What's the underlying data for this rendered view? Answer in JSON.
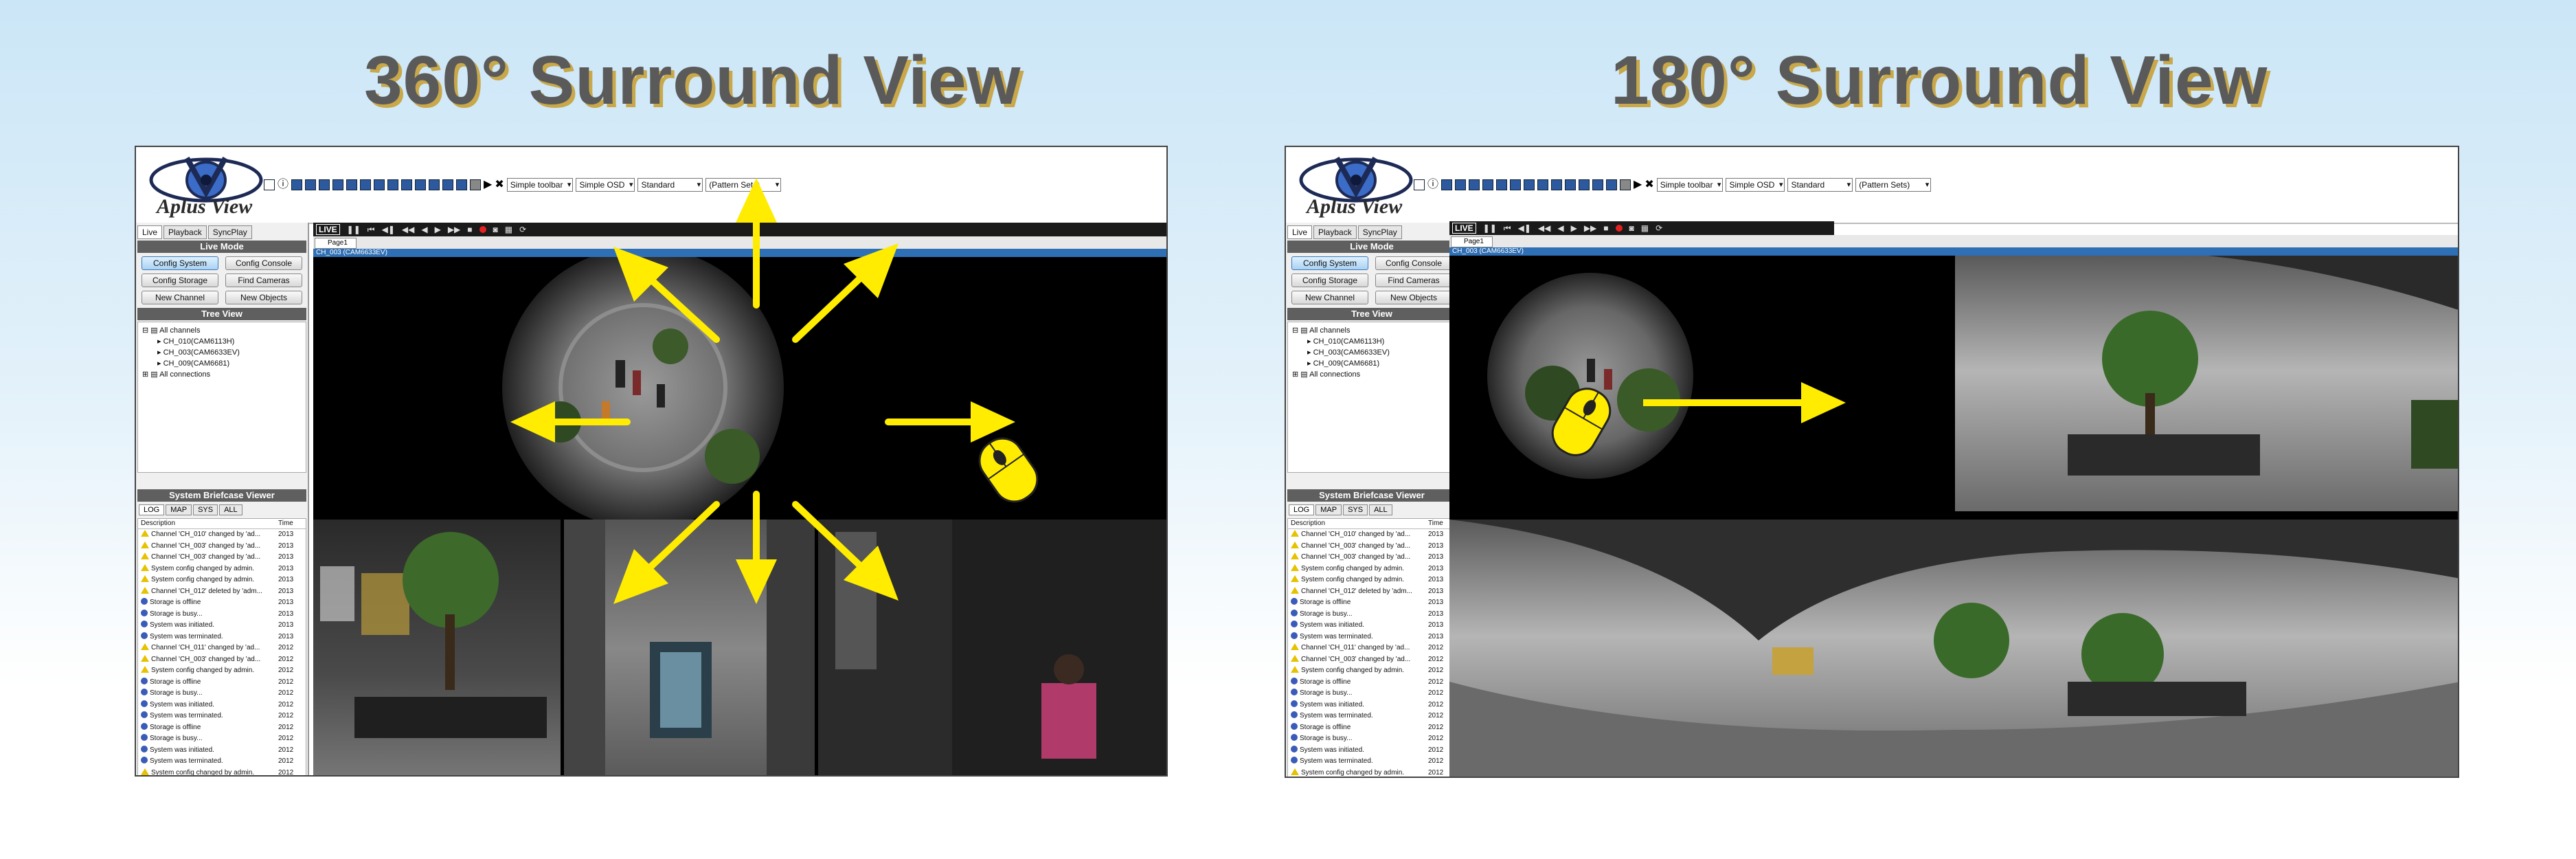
{
  "headings": {
    "left": "360° Surround View",
    "right": "180° Surround View"
  },
  "app": {
    "logo_text": "Aplus View",
    "toolbar_selects": [
      "Simple toolbar",
      "Simple OSD",
      "Standard",
      "(Pattern Sets)"
    ],
    "left_tabs": [
      "Live",
      "Playback",
      "SyncPlay"
    ],
    "live_mode_title": "Live Mode",
    "buttons": [
      "Config System",
      "Config Console",
      "Config Storage",
      "Find Cameras",
      "New Channel",
      "New Objects"
    ],
    "tree_view_title": "Tree View",
    "tree": [
      "All channels",
      "CH_010(CAM6113H)",
      "CH_003(CAM6633EV)",
      "CH_009(CAM6681)",
      "All connections"
    ],
    "briefcase_title": "System Briefcase Viewer",
    "log_tabs": [
      "LOG",
      "MAP",
      "SYS",
      "ALL"
    ],
    "log_header": {
      "desc": "Description",
      "time": "Time"
    },
    "live_label": "LIVE",
    "page_tab": "Page1",
    "cam_title": "CH_003 (CAM6633EV)"
  },
  "log_left": [
    {
      "icon": "warn",
      "text": "Channel 'CH_010' changed by 'ad...",
      "time": "2013"
    },
    {
      "icon": "warn",
      "text": "Channel 'CH_003' changed by 'ad...",
      "time": "2013"
    },
    {
      "icon": "warn",
      "text": "Channel 'CH_003' changed by 'ad...",
      "time": "2013"
    },
    {
      "icon": "warn",
      "text": "System config changed by admin.",
      "time": "2013"
    },
    {
      "icon": "warn",
      "text": "System config changed by admin.",
      "time": "2013"
    },
    {
      "icon": "warn",
      "text": "Channel 'CH_012' deleted by 'adm...",
      "time": "2013"
    },
    {
      "icon": "info",
      "text": "Storage is offline",
      "time": "2013"
    },
    {
      "icon": "info",
      "text": "Storage is busy...",
      "time": "2013"
    },
    {
      "icon": "info",
      "text": "System was initiated.",
      "time": "2013"
    },
    {
      "icon": "info",
      "text": "System was terminated.",
      "time": "2013"
    },
    {
      "icon": "warn",
      "text": "Channel 'CH_011' changed by 'ad...",
      "time": "2012"
    },
    {
      "icon": "warn",
      "text": "Channel 'CH_003' changed by 'ad...",
      "time": "2012"
    },
    {
      "icon": "warn",
      "text": "System config changed by admin.",
      "time": "2012"
    },
    {
      "icon": "info",
      "text": "Storage is offline",
      "time": "2012"
    },
    {
      "icon": "info",
      "text": "Storage is busy...",
      "time": "2012"
    },
    {
      "icon": "info",
      "text": "System was initiated.",
      "time": "2012"
    },
    {
      "icon": "info",
      "text": "System was terminated.",
      "time": "2012"
    },
    {
      "icon": "info",
      "text": "Storage is offline",
      "time": "2012"
    },
    {
      "icon": "info",
      "text": "Storage is busy...",
      "time": "2012"
    },
    {
      "icon": "info",
      "text": "System was initiated.",
      "time": "2012"
    },
    {
      "icon": "info",
      "text": "System was terminated.",
      "time": "2012"
    },
    {
      "icon": "warn",
      "text": "System config changed by admin.",
      "time": "2012"
    },
    {
      "icon": "warn",
      "text": "System config changed by admin.",
      "time": "2012"
    }
  ],
  "log_right": [
    {
      "icon": "warn",
      "text": "Channel 'CH_010' changed by 'ad...",
      "time": "2013"
    },
    {
      "icon": "warn",
      "text": "Channel 'CH_003' changed by 'ad...",
      "time": "2013"
    },
    {
      "icon": "warn",
      "text": "Channel 'CH_003' changed by 'ad...",
      "time": "2013"
    },
    {
      "icon": "warn",
      "text": "System config changed by admin.",
      "time": "2013"
    },
    {
      "icon": "warn",
      "text": "System config changed by admin.",
      "time": "2013"
    },
    {
      "icon": "warn",
      "text": "Channel 'CH_012' deleted by 'adm...",
      "time": "2013"
    },
    {
      "icon": "info",
      "text": "Storage is offline",
      "time": "2013"
    },
    {
      "icon": "info",
      "text": "Storage is busy...",
      "time": "2013"
    },
    {
      "icon": "info",
      "text": "System was initiated.",
      "time": "2013"
    },
    {
      "icon": "info",
      "text": "System was terminated.",
      "time": "2013"
    },
    {
      "icon": "warn",
      "text": "Channel 'CH_011' changed by 'ad...",
      "time": "2012"
    },
    {
      "icon": "warn",
      "text": "Channel 'CH_003' changed by 'ad...",
      "time": "2012"
    },
    {
      "icon": "warn",
      "text": "System config changed by admin.",
      "time": "2012"
    },
    {
      "icon": "info",
      "text": "Storage is offline",
      "time": "2012"
    },
    {
      "icon": "info",
      "text": "Storage is busy...",
      "time": "2012"
    },
    {
      "icon": "info",
      "text": "System was initiated.",
      "time": "2012"
    },
    {
      "icon": "info",
      "text": "System was terminated.",
      "time": "2012"
    },
    {
      "icon": "info",
      "text": "Storage is offline",
      "time": "2012"
    },
    {
      "icon": "info",
      "text": "Storage is busy...",
      "time": "2012"
    },
    {
      "icon": "info",
      "text": "System was initiated.",
      "time": "2012"
    },
    {
      "icon": "info",
      "text": "System was terminated.",
      "time": "2012"
    },
    {
      "icon": "warn",
      "text": "System config changed by admin.",
      "time": "2012"
    },
    {
      "icon": "warn",
      "text": "System config changed by admin.",
      "time": "2012"
    }
  ],
  "colors": {
    "arrow": "#ffec00",
    "heading_text": "#5a5a5a",
    "heading_shadow": "#c8a84a",
    "cam_strip": "#2f6fb5"
  }
}
